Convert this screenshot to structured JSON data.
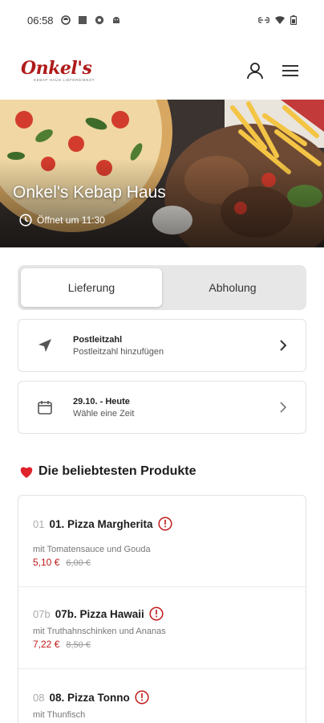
{
  "status_bar": {
    "time": "06:58",
    "left_icons": [
      "notification-circle-icon",
      "square-app-icon",
      "gear-app-icon",
      "android-icon"
    ],
    "right_icons": [
      "link-icon",
      "wifi-icon",
      "battery-icon"
    ]
  },
  "header": {
    "logo_text": "Onkel's",
    "logo_subtext": "Kebap Haus Lieferdienst",
    "account_icon": "user-icon",
    "menu_icon": "hamburger-menu-icon"
  },
  "hero": {
    "title": "Onkel's Kebap Haus",
    "status": "Öffnet um 11:30",
    "status_icon": "clock-icon"
  },
  "order_mode": {
    "options": [
      "Lieferung",
      "Abholung"
    ],
    "selected": "Lieferung"
  },
  "postal_card": {
    "title": "Postleitzahl",
    "subtitle": "Postleitzahl hinzufügen",
    "icon": "location-arrow-icon"
  },
  "time_card": {
    "title": "29.10. - Heute",
    "subtitle": "Wähle eine Zeit",
    "icon": "calendar-icon"
  },
  "popular": {
    "title": "Die beliebtesten Produkte",
    "icon": "heart-icon",
    "products": [
      {
        "number": "01",
        "name": "01. Pizza Margherita",
        "description": "mit Tomatensauce und Gouda",
        "price": "5,10 €",
        "old_price": "6,00 €"
      },
      {
        "number": "07b",
        "name": "07b. Pizza Hawaii",
        "description": "mit Truthahnschinken und Ananas",
        "price": "7,22 €",
        "old_price": "8,50 €"
      },
      {
        "number": "08",
        "name": "08. Pizza Tonno",
        "description": "mit Thunfisch",
        "price": "",
        "old_price": ""
      }
    ]
  },
  "colors": {
    "brand_red": "#b01b1b",
    "price_red": "#c01919",
    "toggle_bg": "#e7e7e7"
  }
}
